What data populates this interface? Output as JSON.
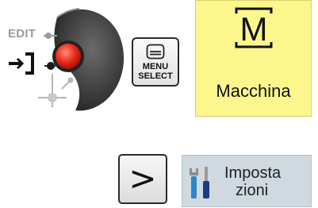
{
  "mode_selector": {
    "mode_label": "EDIT"
  },
  "menu_select_key": {
    "line1": "MENU",
    "line2": "SELECT"
  },
  "machine_softkey": {
    "label": "Macchina",
    "icon": "machine-M-icon",
    "bg_color": "#fcf68d"
  },
  "next_key": {
    "symbol": ">"
  },
  "settings_softkey": {
    "line1": "Imposta",
    "line2": "zioni",
    "icon": "tools-icon",
    "bg_color": "#cfd9df"
  }
}
